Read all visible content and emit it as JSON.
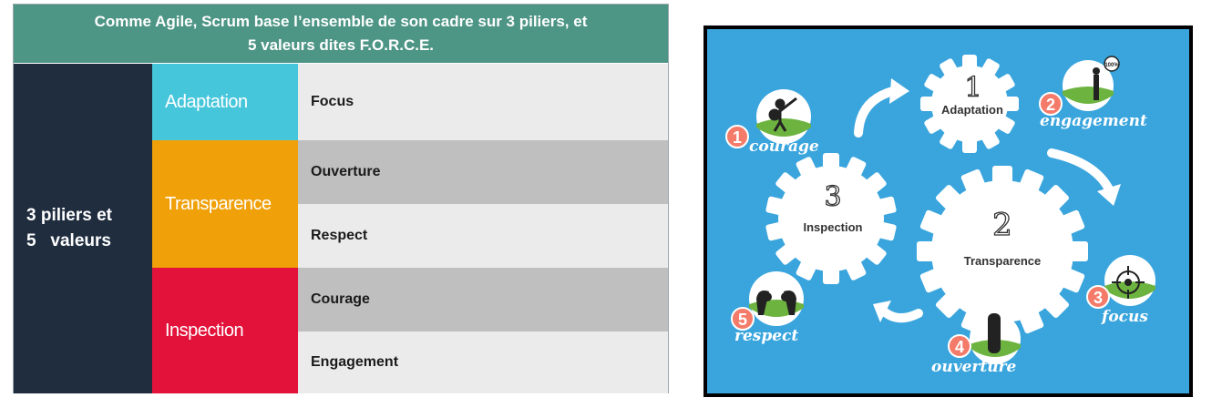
{
  "table": {
    "header_line1": "Comme Agile, Scrum base l’ensemble de son cadre sur 3 piliers, et",
    "header_line2": "5 valeurs dites F.O.R.C.E.",
    "left_line1": "3 piliers et",
    "left_line2": "5   valeurs",
    "pillars": [
      {
        "label": "Adaptation",
        "color": "#46c6db"
      },
      {
        "label": "Transparence",
        "color": "#f0a008"
      },
      {
        "label": "Inspection",
        "color": "#e2123a"
      }
    ],
    "values": [
      "Focus",
      "Ouverture",
      "Respect",
      "Courage",
      "Engagement"
    ],
    "colors": {
      "header": "#4d9585",
      "left": "#1f2d3f",
      "row_light": "#ebebeb",
      "row_dark": "#bfbfbf"
    }
  },
  "diagram": {
    "background": "#3aa5dd",
    "gears": [
      {
        "number": "1",
        "label": "Adaptation"
      },
      {
        "number": "2",
        "label": "Transparence"
      },
      {
        "number": "3",
        "label": "Inspection"
      }
    ],
    "badges": [
      {
        "number": "1",
        "label": "courage",
        "icon": "knight-icon"
      },
      {
        "number": "2",
        "label": "engagement",
        "icon": "person-target-icon"
      },
      {
        "number": "3",
        "label": "focus",
        "icon": "crosshair-icon"
      },
      {
        "number": "4",
        "label": "ouverture",
        "icon": "door-icon"
      },
      {
        "number": "5",
        "label": "respect",
        "icon": "bowing-people-icon"
      }
    ],
    "icon_text": "100%"
  }
}
